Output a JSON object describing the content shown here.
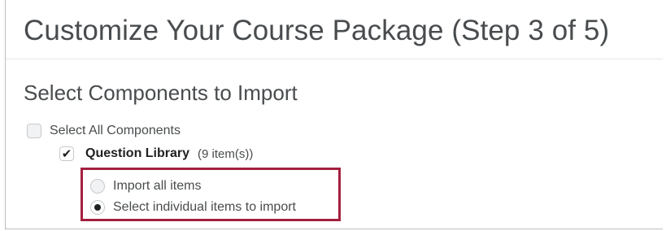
{
  "page": {
    "title": "Customize Your Course Package (Step 3 of 5)",
    "section_title": "Select Components to Import"
  },
  "components": {
    "select_all": {
      "label": "Select All Components",
      "checked": false
    },
    "question_library": {
      "label": "Question Library",
      "count": "(9 item(s))",
      "checked": true,
      "check_glyph": "✔"
    },
    "import_options": [
      {
        "label": "Import all items",
        "selected": false
      },
      {
        "label": "Select individual items to import",
        "selected": true
      }
    ]
  },
  "colors": {
    "text": "#494c4e",
    "text_strong": "#202122",
    "highlight_border": "#a3213f",
    "control_border": "#c7c9cc",
    "control_bg": "#f1f2f3"
  }
}
